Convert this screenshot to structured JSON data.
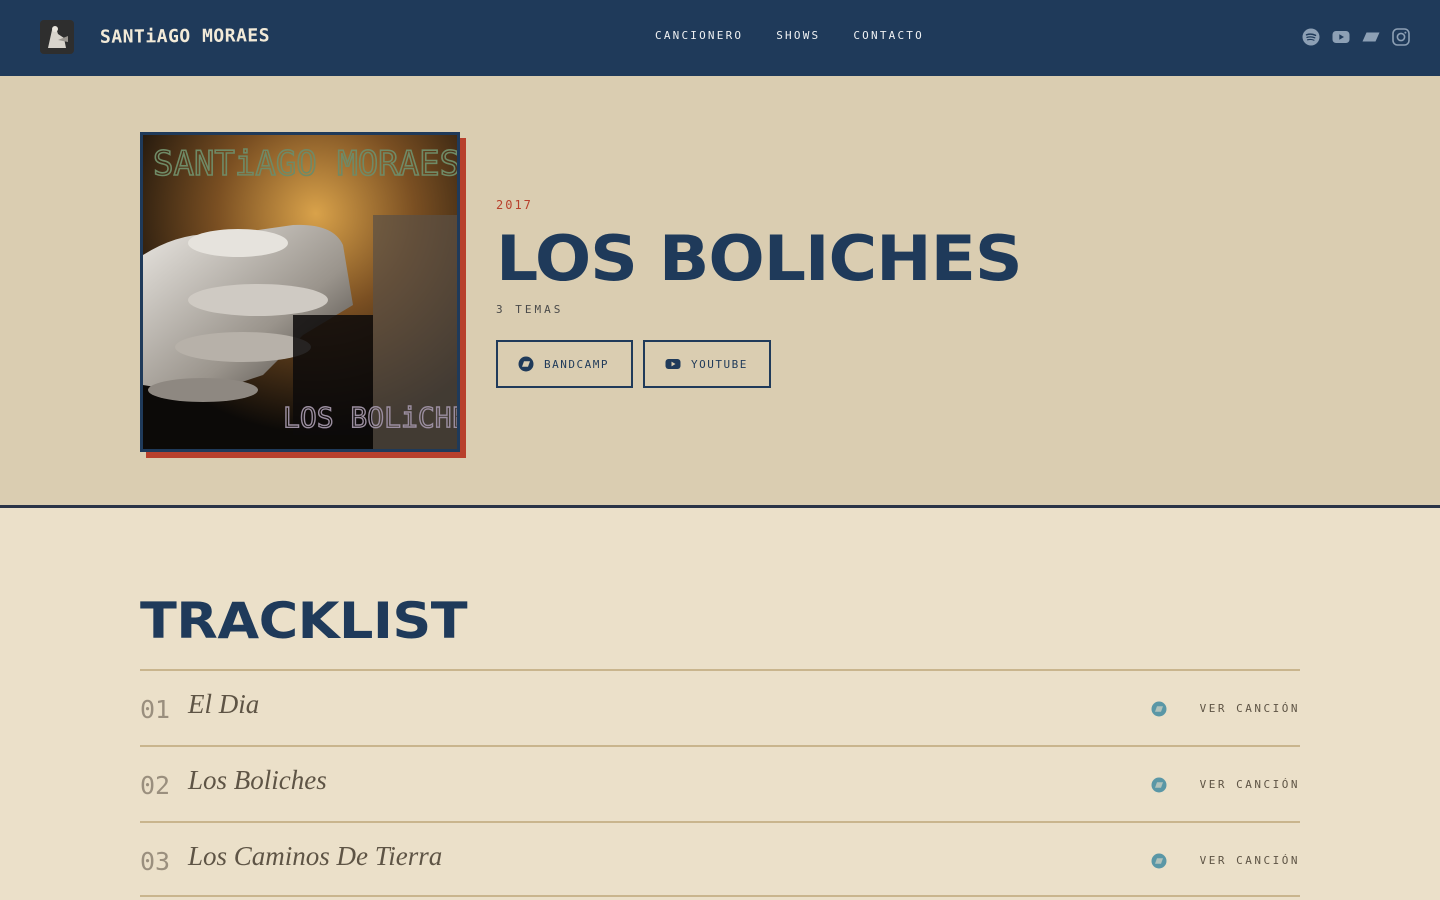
{
  "header": {
    "brand": "SANTiAGO MORAES",
    "nav": [
      "CANCIONERO",
      "SHOWS",
      "CONTACTO"
    ],
    "social_icons": [
      "spotify-icon",
      "youtube-icon",
      "bandcamp-icon",
      "instagram-icon"
    ]
  },
  "album": {
    "cover_text_top": "SANTiAGO MORAES",
    "cover_text_bottom": "LOS BOLiCHES",
    "year": "2017",
    "title": "LOS BOLICHES",
    "tracks_count": "3 TEMAS",
    "buttons": {
      "bandcamp": "BANDCAMP",
      "youtube": "YOUTUBE"
    }
  },
  "tracklist": {
    "title": "TRACKLIST",
    "link_label": "VER CANCIÓN",
    "tracks": [
      {
        "num": "01",
        "name": "El Dia"
      },
      {
        "num": "02",
        "name": "Los Boliches"
      },
      {
        "num": "03",
        "name": "Los Caminos De Tierra"
      }
    ]
  },
  "colors": {
    "nav_bg": "#1f3a5a",
    "hero_bg": "#dacdb1",
    "page_bg": "#ebe0c9",
    "accent_red": "#b8402c",
    "primary_blue": "#1f3a5a",
    "track_icon": "#5a97a6"
  }
}
